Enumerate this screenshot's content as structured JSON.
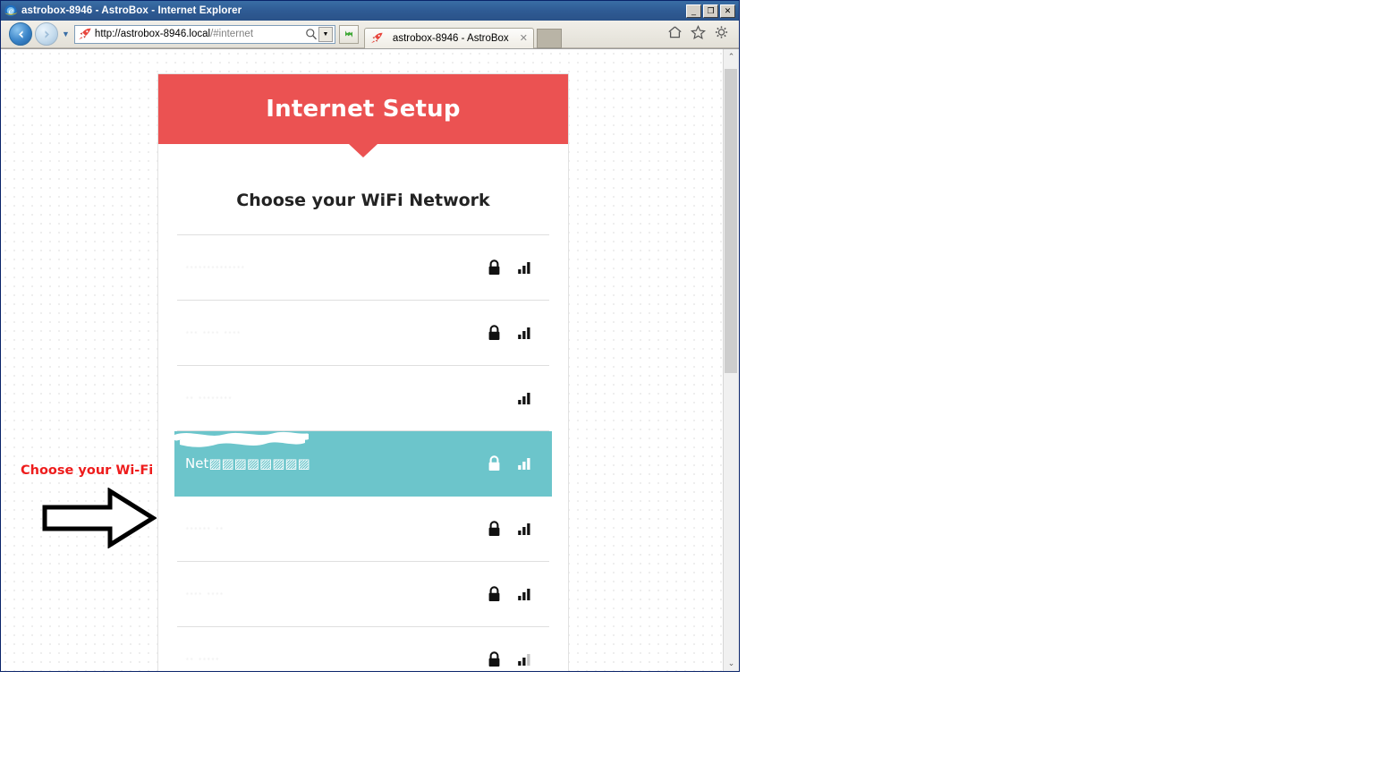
{
  "browser": {
    "app_name": "Internet Explorer",
    "window_title": "astrobox-8946 - AstroBox - Internet Explorer",
    "minimize_label": "_",
    "maximize_label": "❐",
    "close_label": "✕",
    "back_label": "◀",
    "forward_label": "▶",
    "history_dropdown_label": "▼",
    "address": {
      "url_host": "http://astrobox-8946.local",
      "url_path": "/#internet",
      "full_url": "http://astrobox-8946.local/#internet",
      "dropdown_label": "▼"
    },
    "refresh_icon": "refresh-icon",
    "tab": {
      "title": "astrobox-8946 - AstroBox",
      "close_label": "✕",
      "favicon": "rocket-icon"
    },
    "new_tab_label": "",
    "toolbar_icons": [
      "home-icon",
      "favorites-star-icon",
      "settings-gear-icon"
    ],
    "scrollbar": {
      "up_arrow": "⌃",
      "down_arrow": "⌄"
    }
  },
  "page": {
    "header_title": "Internet Setup",
    "section_title": "Choose your WiFi Network",
    "header_color": "#eb5252",
    "selected_color": "#6cc5cb",
    "networks": [
      {
        "ssid": "··············",
        "secured": true,
        "signal": 2,
        "selected": false
      },
      {
        "ssid": "··· ···· ····",
        "secured": true,
        "signal": 2,
        "selected": false
      },
      {
        "ssid": "·· ········",
        "secured": false,
        "signal": 2,
        "selected": false
      },
      {
        "ssid": "Net▨▨▨▨▨▨▨▨",
        "secured": true,
        "signal": 2,
        "selected": true
      },
      {
        "ssid": "······ ··",
        "secured": true,
        "signal": 2,
        "selected": false
      },
      {
        "ssid": "···· ····",
        "secured": true,
        "signal": 2,
        "selected": false
      },
      {
        "ssid": "·· ·····",
        "secured": true,
        "signal": 1,
        "selected": false
      }
    ]
  },
  "annotation": {
    "label": "Choose your Wi-Fi",
    "label_color": "#ee1c1c",
    "arrow_direction": "right"
  }
}
